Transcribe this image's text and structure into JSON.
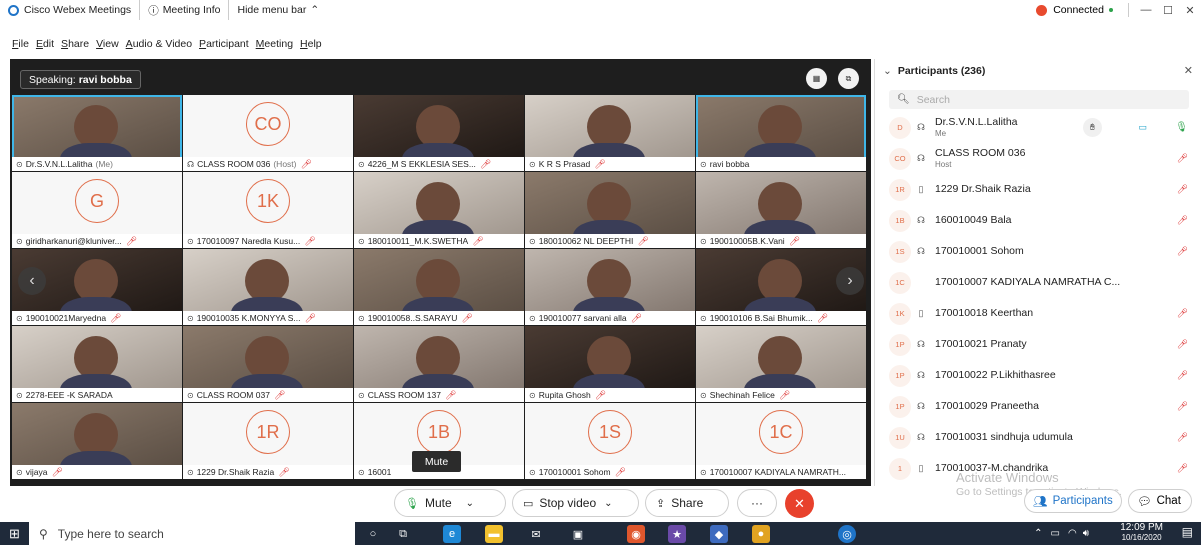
{
  "titlebar": {
    "app_name": "Cisco Webex Meetings",
    "meeting_info": "Meeting Info",
    "hide_menu": "Hide menu bar",
    "status": "Connected",
    "minimize": "—",
    "maximize": "☐",
    "close": "✕"
  },
  "menu": [
    "File",
    "Edit",
    "Share",
    "View",
    "Audio & Video",
    "Participant",
    "Meeting",
    "Help"
  ],
  "stage": {
    "speaking_label": "Speaking:",
    "speaking_name": "ravi bobba",
    "tiles": [
      {
        "label": "Dr.S.V.N.L.Lalitha",
        "suffix": "(Me)",
        "kind": "video",
        "muted": false
      },
      {
        "label": "CLASS ROOM 036",
        "suffix": "(Host)",
        "kind": "avatar",
        "initials": "CO",
        "muted": true
      },
      {
        "label": "4226_M S EKKLESIA SES...",
        "kind": "video",
        "muted": true
      },
      {
        "label": "K R S Prasad",
        "kind": "video",
        "muted": true
      },
      {
        "label": "ravi bobba",
        "kind": "video",
        "muted": false
      },
      {
        "label": "giridharkanuri@kluniver...",
        "kind": "avatar",
        "initials": "G",
        "muted": true
      },
      {
        "label": "170010097 Naredla Kusu...",
        "kind": "avatar",
        "initials": "1K",
        "muted": true
      },
      {
        "label": "180010011_M.K.SWETHA",
        "kind": "video",
        "muted": true
      },
      {
        "label": "180010062 NL DEEPTHI",
        "kind": "video",
        "muted": true
      },
      {
        "label": "190010005B.K.Vani",
        "kind": "video",
        "muted": true
      },
      {
        "label": "190010021Maryedna",
        "kind": "video",
        "muted": true
      },
      {
        "label": "190010035 K.MONYYA S...",
        "kind": "video",
        "muted": true
      },
      {
        "label": "190010058..S.SARAYU",
        "kind": "video",
        "muted": true
      },
      {
        "label": "190010077 sarvani alla",
        "kind": "video",
        "muted": true
      },
      {
        "label": "190010106 B.Sai Bhumik...",
        "kind": "video",
        "muted": true
      },
      {
        "label": "2278-EEE -K SARADA",
        "kind": "video",
        "muted": false
      },
      {
        "label": "CLASS ROOM 037",
        "kind": "video",
        "muted": true
      },
      {
        "label": "CLASS ROOM 137",
        "kind": "video",
        "muted": true
      },
      {
        "label": "Rupita Ghosh",
        "kind": "video",
        "muted": true
      },
      {
        "label": "Shechinah Felice",
        "kind": "video",
        "muted": true
      },
      {
        "label": "vijaya",
        "kind": "video",
        "muted": true
      },
      {
        "label": "1229 Dr.Shaik Razia",
        "kind": "avatar",
        "initials": "1R",
        "muted": true
      },
      {
        "label": "16001",
        "kind": "avatar",
        "initials": "1B",
        "muted": false
      },
      {
        "label": "170010001 Sohom",
        "kind": "avatar",
        "initials": "1S",
        "muted": true
      },
      {
        "label": "170010007 KADIYALA NAMRATH...",
        "kind": "avatar",
        "initials": "1C",
        "muted": false
      }
    ],
    "tooltip": "Mute"
  },
  "controls": {
    "mute": "Mute",
    "stop_video": "Stop video",
    "share": "Share",
    "more": "···",
    "participants": "Participants",
    "chat": "Chat"
  },
  "panel": {
    "title": "Participants (236)",
    "search_placeholder": "Search",
    "participants": [
      {
        "initials": "D",
        "name": "Dr.S.V.N.L.Lalitha",
        "role": "Me",
        "muted": false
      },
      {
        "initials": "CO",
        "name": "CLASS ROOM 036",
        "role": "Host",
        "muted": true
      },
      {
        "initials": "1R",
        "name": "1229 Dr.Shaik Razia",
        "role": "",
        "muted": true
      },
      {
        "initials": "1B",
        "name": "160010049 Bala",
        "role": "",
        "muted": true
      },
      {
        "initials": "1S",
        "name": "170010001 Sohom",
        "role": "",
        "muted": true
      },
      {
        "initials": "1C",
        "name": "170010007 KADIYALA NAMRATHA C...",
        "role": "",
        "muted": false
      },
      {
        "initials": "1K",
        "name": "170010018 Keerthan",
        "role": "",
        "muted": true
      },
      {
        "initials": "1P",
        "name": "170010021 Pranaty",
        "role": "",
        "muted": true
      },
      {
        "initials": "1P",
        "name": "170010022 P.Likhithasree",
        "role": "",
        "muted": true
      },
      {
        "initials": "1P",
        "name": "170010029 Praneetha",
        "role": "",
        "muted": true
      },
      {
        "initials": "1U",
        "name": "170010031 sindhuja udumula",
        "role": "",
        "muted": true
      },
      {
        "initials": "1",
        "name": "170010037-M.chandrika",
        "role": "",
        "muted": true
      }
    ]
  },
  "watermark": {
    "line1": "Activate Windows",
    "line2": "Go to Settings to activate Windows."
  },
  "taskbar": {
    "search_placeholder": "Type here to search",
    "time": "12:09 PM",
    "date": "10/16/2020"
  }
}
